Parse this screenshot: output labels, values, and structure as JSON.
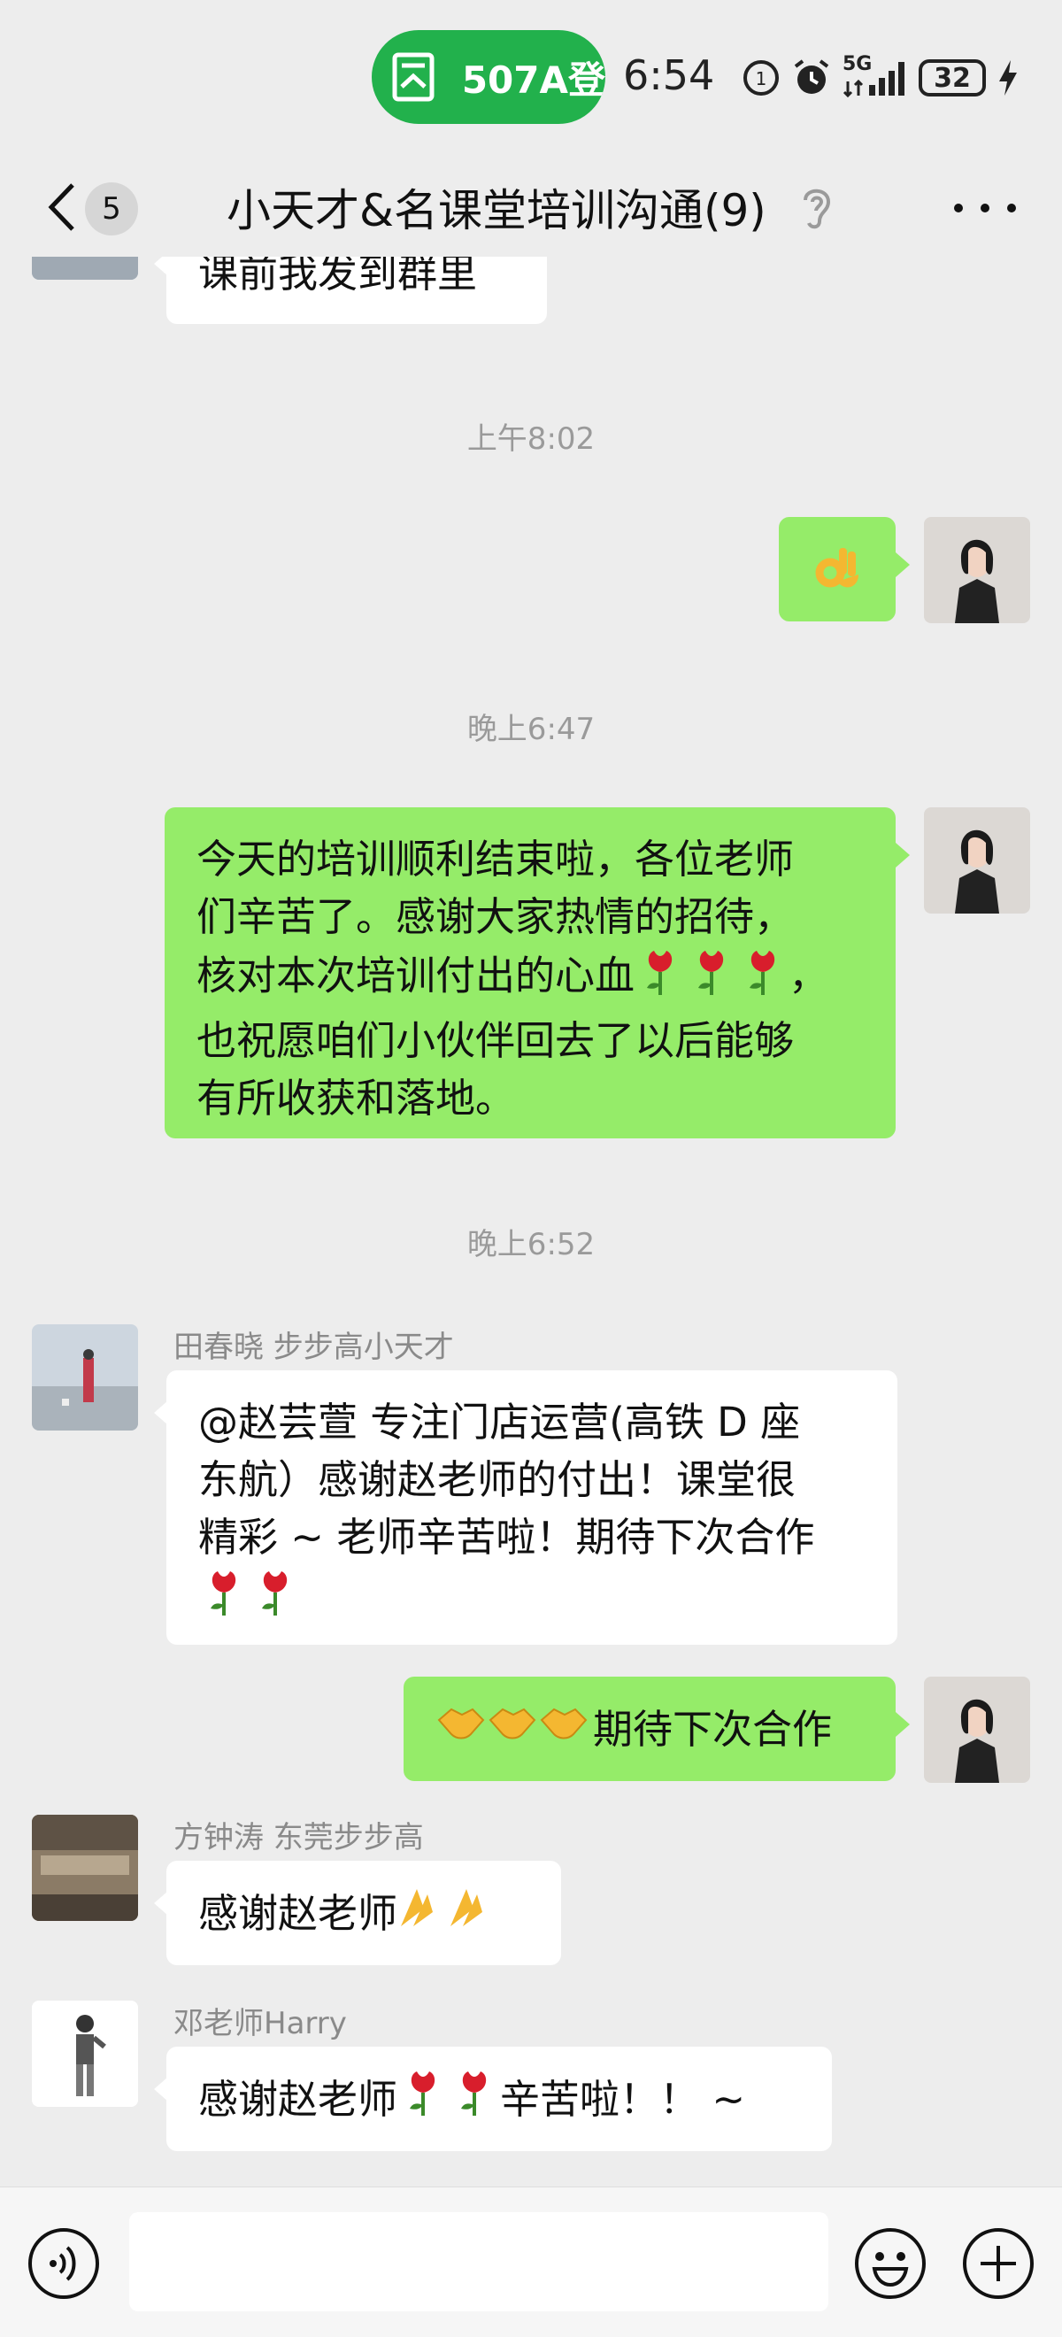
{
  "status_bar": {
    "pill_text": "507A登",
    "time": "6:54",
    "network": "5G",
    "battery": "32"
  },
  "header": {
    "back_badge": "5",
    "title": "小天才&名课堂培训沟通(9)"
  },
  "messages": {
    "m0": {
      "text": "课前我发到群里"
    },
    "t1": "上午8:02",
    "t2": "晚上6:47",
    "m2": {
      "lines": [
        "今天的培训顺利结束啦，各位老师",
        "们辛苦了。感谢大家热情的招待，",
        "核对本次培训付出的心血",
        "，",
        "也祝愿咱们小伙伴回去了以后能够",
        "有所收获和落地。"
      ]
    },
    "t3": "晚上6:52",
    "m3": {
      "sender": "田春晓 步步高小天才",
      "lines": [
        "@赵芸萱 专注门店运营(高铁 D 座",
        "东航）感谢赵老师的付出！课堂很",
        "精彩 ~ 老师辛苦啦！期待下次合作"
      ]
    },
    "m4": {
      "text": "期待下次合作"
    },
    "m5": {
      "sender": "方钟涛 东莞步步高",
      "text": "感谢赵老师"
    },
    "m6": {
      "sender": "邓老师Harry",
      "text_a": "感谢赵老师",
      "text_b": "辛苦啦！！ ~"
    }
  },
  "input": {
    "placeholder": ""
  },
  "colors": {
    "background": "#ededed",
    "outgoing_bubble": "#95ec69",
    "incoming_bubble": "#ffffff",
    "pill": "#22b14c"
  },
  "icons": {
    "ok_hand": "ok-hand-emoji",
    "rose": "rose-emoji",
    "handshake": "handshake-emoji",
    "clap": "folded-hands-emoji"
  }
}
